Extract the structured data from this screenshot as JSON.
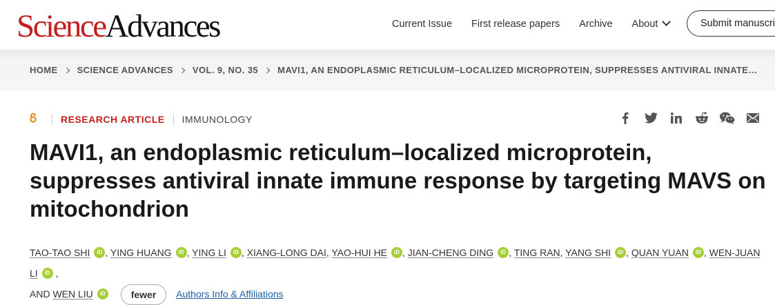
{
  "header": {
    "logo_science": "Science",
    "logo_advances": "Advances",
    "nav": [
      "Current Issue",
      "First release papers",
      "Archive",
      "About"
    ],
    "submit_label": "Submit manuscri"
  },
  "breadcrumb": [
    "HOME",
    "SCIENCE ADVANCES",
    "VOL. 9, NO. 35",
    "MAVI1, AN ENDOPLASMIC RETICULUM–LOCALIZED MICROPROTEIN, SUPPRESSES ANTIVIRAL INNATE…"
  ],
  "article": {
    "access_icon": "open-access-icon",
    "type": "RESEARCH ARTICLE",
    "subject": "IMMUNOLOGY",
    "title": "MAVI1, an endoplasmic reticulum–localized microprotein, suppresses antiviral innate immune response by targeting MAVS on mitochondrion",
    "authors_line1": [
      {
        "name": "TAO-TAO SHI",
        "orcid": true
      },
      {
        "name": "YING HUANG",
        "orcid": true
      },
      {
        "name": "YING LI",
        "orcid": true
      },
      {
        "name": "XIANG-LONG DAI",
        "orcid": false
      },
      {
        "name": "YAO-HUI HE",
        "orcid": true
      },
      {
        "name": "JIAN-CHENG DING",
        "orcid": true
      },
      {
        "name": "TING RAN",
        "orcid": false
      },
      {
        "name": "YANG SHI",
        "orcid": true
      },
      {
        "name": "QUAN YUAN",
        "orcid": true
      },
      {
        "name": "WEN-JUAN LI",
        "orcid": true
      }
    ],
    "and_text": "AND",
    "last_author": "WEN LIU",
    "orcid_text": "iD",
    "fewer_label": "fewer",
    "affiliations_label": "Authors Info & Affiliations"
  },
  "share_icons": [
    "facebook-icon",
    "twitter-icon",
    "linkedin-icon",
    "reddit-icon",
    "wechat-icon",
    "email-icon"
  ],
  "colors": {
    "brand_red": "#c41e1e",
    "orcid_green": "#a6ce39",
    "link_blue": "#1f5fa8",
    "open_access_orange": "#e6830f"
  }
}
